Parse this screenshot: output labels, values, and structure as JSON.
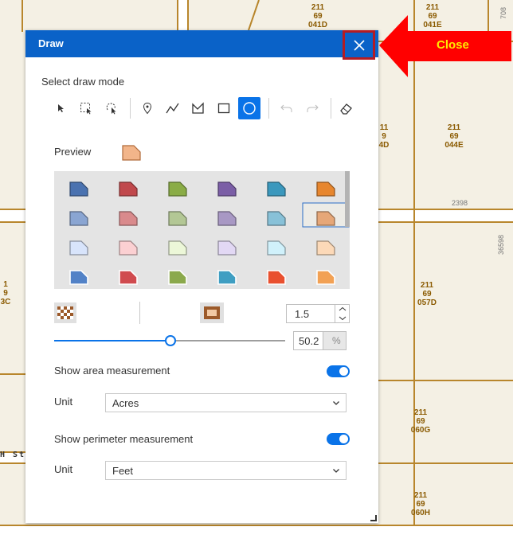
{
  "map": {
    "parcels": [
      {
        "line1": "211",
        "line2": "69",
        "line3": "041D"
      },
      {
        "line1": "211",
        "line2": "69",
        "line3": "041E"
      },
      {
        "line1": "11",
        "line2": "9",
        "line3": "4D"
      },
      {
        "line1": "211",
        "line2": "69",
        "line3": "044E"
      },
      {
        "line1": "211",
        "line2": "69",
        "line3": "057D"
      },
      {
        "line1": "211",
        "line2": "69",
        "line3": "060G"
      },
      {
        "line1": "211",
        "line2": "69",
        "line3": "060H"
      },
      {
        "line1": "1",
        "line2": "9",
        "line3": "3C"
      }
    ],
    "road_labels": [
      "2398",
      "36598",
      "708"
    ],
    "street_label": "H St"
  },
  "panel": {
    "title": "Draw",
    "draw_mode_label": "Select draw mode",
    "tools": [
      "pointer-select-icon",
      "rectangle-select-icon",
      "lasso-select-icon",
      "point-icon",
      "polyline-icon",
      "freehand-polygon-icon",
      "rectangle-icon",
      "circle-icon"
    ],
    "active_tool": "circle-icon",
    "preview_label": "Preview",
    "palette_colors": [
      [
        "#4a72b0",
        "#c0484c",
        "#8aac46",
        "#7b5ea6",
        "#3b98bd",
        "#e7862e"
      ],
      [
        "#8aa5d2",
        "#d98a8c",
        "#b3c795",
        "#a898c4",
        "#88c1d8",
        "#e6a778"
      ],
      [
        "#d8e4fb",
        "#fbd0d2",
        "#ecf7d8",
        "#e2d8f4",
        "#d0f1fb",
        "#fcd9b8"
      ],
      [
        "#5282c7",
        "#d04b4f",
        "#8ba94c",
        "#3f9ec2",
        "#e9502f",
        "#f2a154"
      ]
    ],
    "selected_swatch": "row2-col6",
    "stroke_width": "1.5",
    "transparency": "50.2",
    "transparency_unit": "%",
    "slider_value": 0.502,
    "area": {
      "label": "Show area measurement",
      "unit_label": "Unit",
      "unit": "Acres",
      "enabled": true
    },
    "perimeter": {
      "label": "Show perimeter measurement",
      "unit_label": "Unit",
      "unit": "Feet",
      "enabled": true
    }
  },
  "annotation": {
    "label": "Close",
    "color": "#ff0000",
    "text_color": "#ffec00"
  },
  "colors": {
    "header": "#0a62c8",
    "accent": "#0a73e8",
    "parcel_line": "#b8862c"
  }
}
